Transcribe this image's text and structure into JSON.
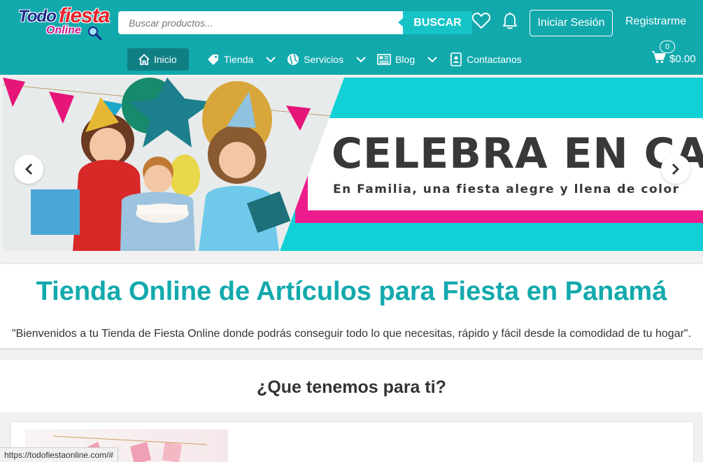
{
  "header": {
    "logo": {
      "word1": "Todo",
      "word2": "fiesta",
      "word3": "Online"
    },
    "search_placeholder": "Buscar productos...",
    "search_button": "BUSCAR",
    "login_label": "Iniciar Sesión",
    "register_label": "Registrarme",
    "nav": [
      {
        "label": "Inicio",
        "icon": "home-icon"
      },
      {
        "label": "Tienda",
        "icon": "tag-icon"
      },
      {
        "label": "Servicios",
        "icon": "globe-icon"
      },
      {
        "label": "Blog",
        "icon": "newspaper-icon"
      },
      {
        "label": "Contactanos",
        "icon": "contact-icon"
      }
    ],
    "cart": {
      "count": "0",
      "total": "$0.00"
    }
  },
  "banner": {
    "title": "CELEBRA EN CASA",
    "subtitle": "En Familia, una fiesta alegre y llena de color"
  },
  "intro": {
    "heading": "Tienda Online de Artículos para Fiesta en Panamá",
    "text": "\"Bienvenidos a tu Tienda de Fiesta Online donde podrás conseguir todo lo que necesitas, rápido y fácil desde la comodidad de tu hogar\"."
  },
  "offer": {
    "heading": "¿Que tenemos para ti?"
  },
  "status_url": "https://todofiestaonline.com/#",
  "colors": {
    "brand": "#12a9ad",
    "accent": "#16c4c8",
    "pink": "#ec1c8c"
  }
}
